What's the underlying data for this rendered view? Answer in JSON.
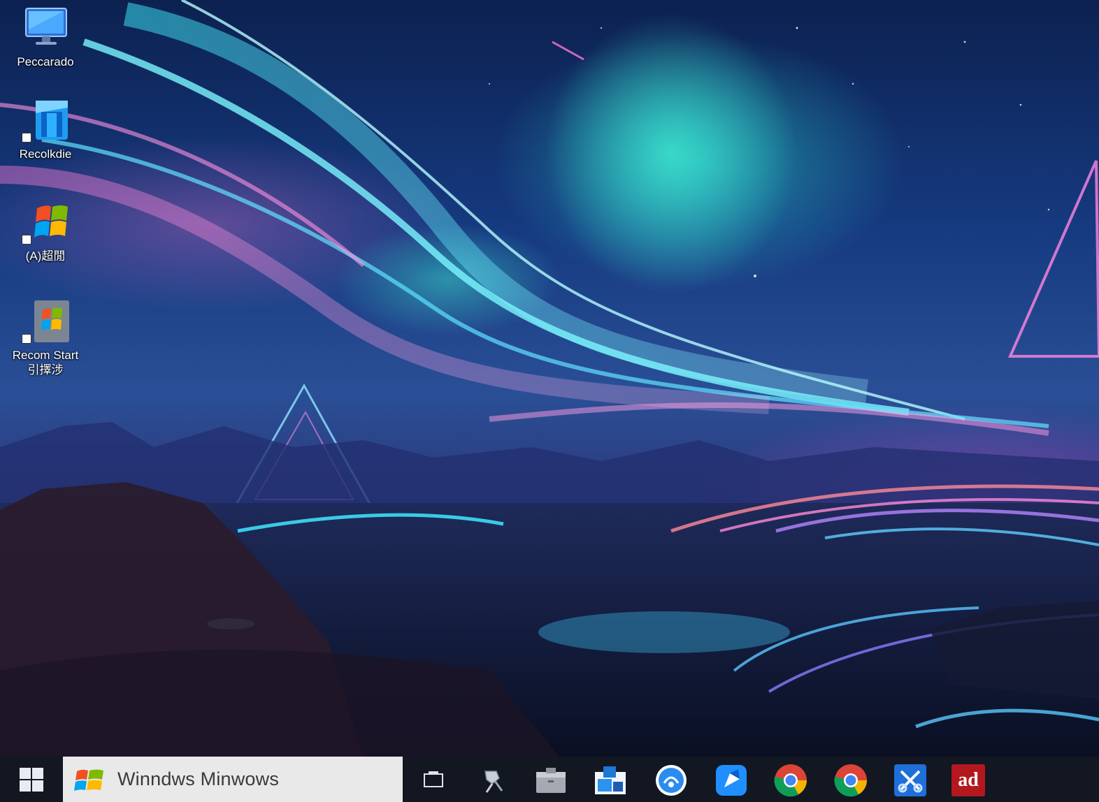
{
  "desktop": {
    "icons": [
      {
        "label": "Peccarado",
        "icon": "monitor-icon"
      },
      {
        "label": "Recolkdie",
        "icon": "folder-blue-icon"
      },
      {
        "label": "(A)超閒",
        "icon": "windows-logo-icon"
      },
      {
        "label": "Recom Start\n引擇涉",
        "icon": "windows-logo-grey-icon"
      }
    ]
  },
  "taskbar": {
    "start_icon": "windows-start-icon",
    "search": {
      "icon": "windows-flag-icon",
      "text": "Winndws Minwows"
    },
    "apps": [
      {
        "icon": "task-view-icon"
      },
      {
        "icon": "pin-tool-icon"
      },
      {
        "icon": "file-cabinet-icon"
      },
      {
        "icon": "blue-window-icon"
      },
      {
        "icon": "blue-circle-app-icon"
      },
      {
        "icon": "blue-arrow-app-icon"
      },
      {
        "icon": "chrome-icon"
      },
      {
        "icon": "chrome-icon"
      },
      {
        "icon": "snip-tool-icon"
      },
      {
        "icon": "red-app-icon",
        "text": "ad"
      }
    ]
  },
  "colors": {
    "taskbar": "#121722",
    "search_box": "#e9e9ea",
    "aurora_cyan": "#2ee0e0",
    "aurora_pink": "#e070d0"
  }
}
